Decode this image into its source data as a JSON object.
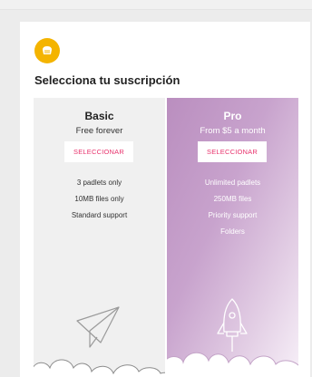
{
  "page": {
    "title": "Selecciona tu suscripción",
    "logo_icon": "padlet-logo-icon"
  },
  "plans": {
    "basic": {
      "name": "Basic",
      "price": "Free forever",
      "button": "SELECCIONAR",
      "features": [
        "3 padlets only",
        "10MB files only",
        "Standard support"
      ],
      "illustration": "paper-plane-icon"
    },
    "pro": {
      "name": "Pro",
      "price": "From $5 a month",
      "button": "SELECCIONAR",
      "features": [
        "Unlimited padlets",
        "250MB files",
        "Priority support",
        "Folders"
      ],
      "illustration": "rocket-icon"
    }
  },
  "colors": {
    "accent": "#e8336d",
    "logo": "#f4b400",
    "pro_gradient_start": "#ba8ebf"
  }
}
